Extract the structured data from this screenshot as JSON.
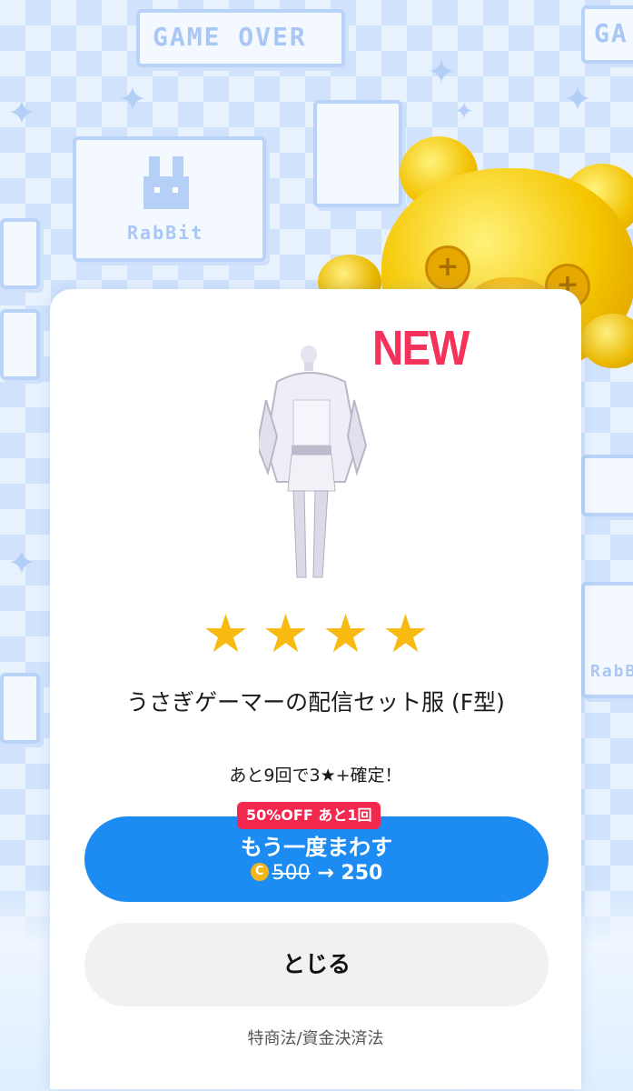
{
  "background": {
    "game_over_text": "GAME OVER",
    "game_over_partial": "GA",
    "rabbit_label": "RabBit",
    "rabbit_label_2": "RabBit"
  },
  "modal": {
    "new_badge": "NEW",
    "rarity_stars": 4,
    "star_glyph": "★",
    "item_name": "うさぎゲーマーの配信セット服 (F型)",
    "guarantee_text": "あと9回で3★+確定！",
    "discount_tag": "50%OFF あと1回",
    "spin_again_label": "もう一度まわす",
    "coin_icon": "C",
    "old_price": "500",
    "price_arrow": "→",
    "new_price": "250",
    "close_label": "とじる",
    "legal_link": "特商法/資金決済法"
  },
  "colors": {
    "accent_blue": "#1c8cf2",
    "badge_red": "#f2284f",
    "new_red": "#f5325a",
    "star_gold": "#f8b911"
  }
}
